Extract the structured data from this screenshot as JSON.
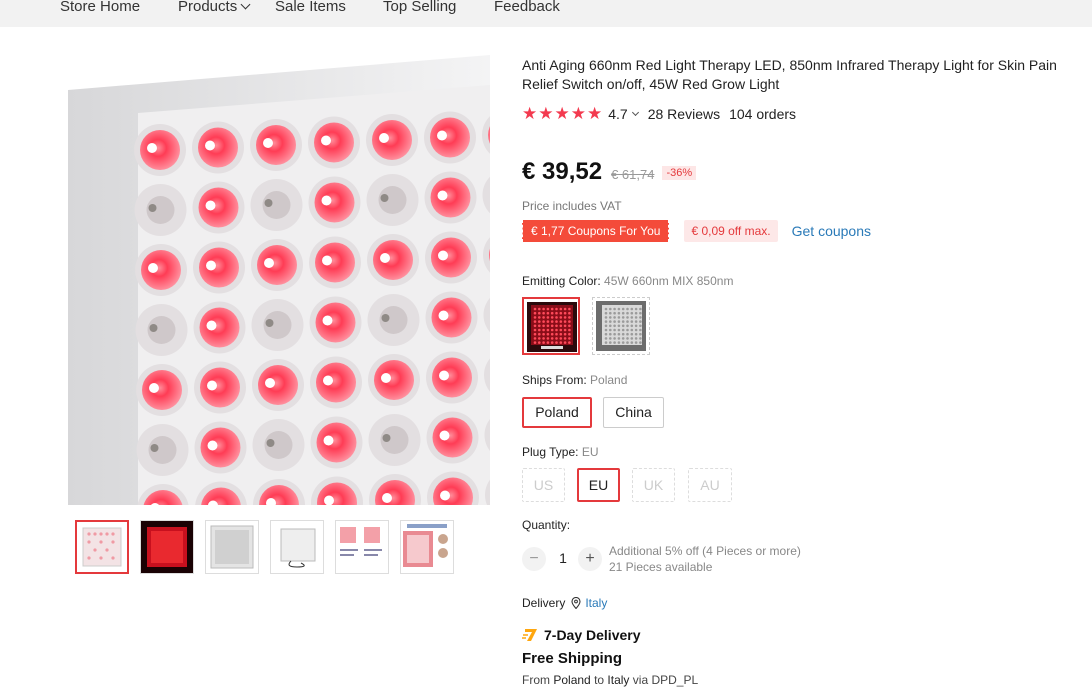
{
  "nav": {
    "items": [
      "Store Home",
      "Products",
      "Sale Items",
      "Top Selling",
      "Feedback"
    ]
  },
  "product": {
    "title": "Anti Aging 660nm Red Light Therapy LED, 850nm Infrared Therapy Light for Skin Pain Relief Switch on/off, 45W Red Grow Light",
    "rating": "4.7",
    "stars": 5,
    "reviews": "28 Reviews",
    "orders": "104 orders"
  },
  "price": {
    "current": "€ 39,52",
    "original": "€ 61,74",
    "discount": "-36%",
    "vat_note": "Price includes VAT"
  },
  "coupons": {
    "coupon_label": "€ 1,77 Coupons For You",
    "off_max": "€ 0,09 off max.",
    "get_coupons": "Get coupons"
  },
  "emitting_color": {
    "label": "Emitting Color:",
    "value": "45W 660nm MIX 850nm"
  },
  "ships_from": {
    "label": "Ships From:",
    "value": "Poland",
    "options": [
      "Poland",
      "China"
    ]
  },
  "plug_type": {
    "label": "Plug Type:",
    "value": "EU",
    "options": [
      "US",
      "EU",
      "UK",
      "AU"
    ]
  },
  "quantity": {
    "label": "Quantity:",
    "value": "1",
    "minus": "−",
    "plus": "+",
    "discount_note": "Additional 5% off (4 Pieces or more)",
    "available": "21 Pieces available"
  },
  "delivery": {
    "label": "Delivery",
    "country": "Italy",
    "badge": "7-Day Delivery",
    "free_shipping": "Free Shipping",
    "from_prefix": "From",
    "from_country": "Poland",
    "to_prefix": "to",
    "to_country": "Italy",
    "via": "via DPD_PL"
  },
  "colors": {
    "accent": "#e4393c",
    "star": "#f33a4f",
    "link": "#2a7ab8",
    "led_red": "#ff2a44"
  }
}
